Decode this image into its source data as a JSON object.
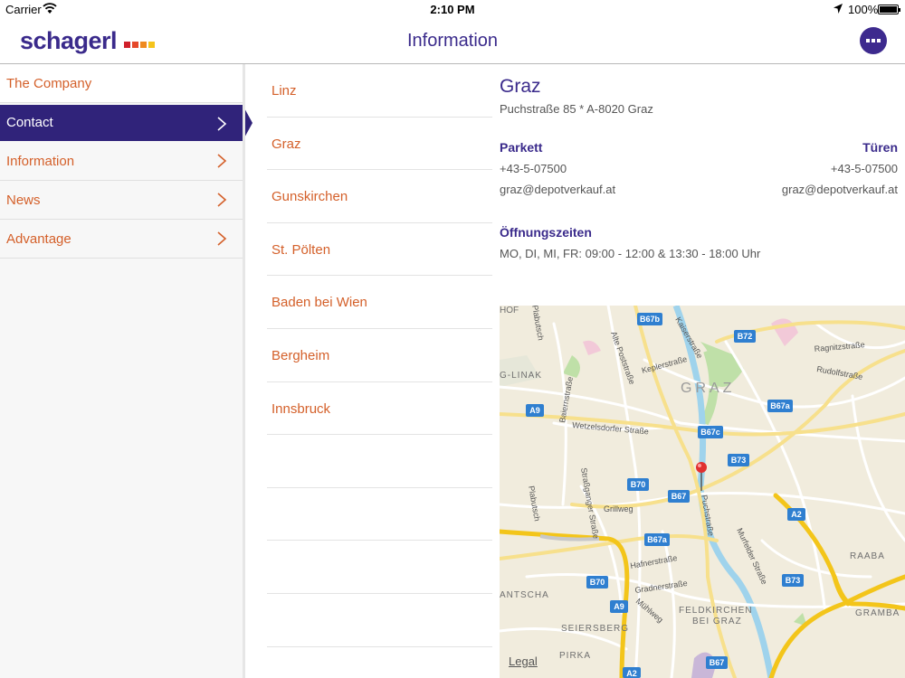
{
  "status_bar": {
    "carrier": "Carrier",
    "time": "2:10 PM",
    "battery": "100%"
  },
  "header": {
    "logo_text": "schagerl",
    "title": "Information"
  },
  "sidebar": {
    "items": [
      {
        "label": "The Company",
        "has_chevron": false
      },
      {
        "label": "Contact",
        "active": true
      },
      {
        "label": "Information"
      },
      {
        "label": "News"
      },
      {
        "label": "Advantage"
      }
    ]
  },
  "locations": [
    "Linz",
    "Graz",
    "Gunskirchen",
    "St. Pölten",
    "Baden bei Wien",
    "Bergheim",
    "Innsbruck"
  ],
  "detail": {
    "city": "Graz",
    "address": "Puchstraße 85 * A-8020 Graz",
    "parkett": {
      "heading": "Parkett",
      "phone": "+43-5-07500",
      "email": "graz@depotverkauf.at"
    },
    "tueren": {
      "heading": "Türen",
      "phone": "+43-5-07500",
      "email": "graz@depotverkauf.at"
    },
    "hours_heading": "Öffnungszeiten",
    "hours": "MO, DI, MI, FR: 09:00 - 12:00  &  13:30 - 18:00 Uhr"
  },
  "map": {
    "legal": "Legal",
    "city_label": "GRAZ",
    "area_labels": [
      "HOF",
      "G-LINAK",
      "ANTSCHA",
      "SEIERSBERG",
      "PIRKA",
      "FELDKIRCHEN",
      "BEI GRAZ",
      "RAABA",
      "GRAMBA"
    ],
    "streets": [
      "Plabutsch",
      "Alte Poststraße",
      "Kaiserstraße",
      "Keplerstraße",
      "Baiernstraße",
      "Wetzelsdorfer Straße",
      "Straßganger Straße",
      "Grillweg",
      "Puchstraße",
      "Murfelder Straße",
      "Hafnerstraße",
      "Gradnerstraße",
      "Mühlweg",
      "Ragnitzstraße",
      "Rudolfstraße",
      "Plabutsch"
    ],
    "road_badges": [
      "B67b",
      "B72",
      "A9",
      "B67a",
      "B67c",
      "B73",
      "B70",
      "B67",
      "A2",
      "B67a",
      "B70",
      "B73",
      "A9",
      "B67",
      "A2"
    ]
  },
  "colors": {
    "brand": "#3a2a8b",
    "accent": "#d4602a",
    "active_bg": "#30237a"
  }
}
